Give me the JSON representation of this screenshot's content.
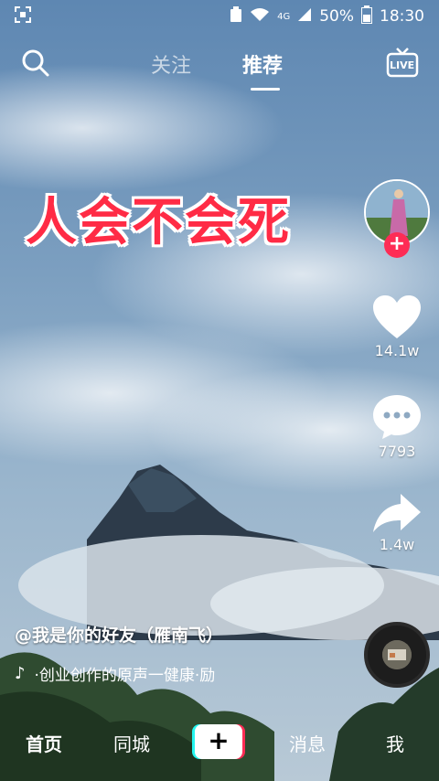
{
  "status_bar": {
    "battery": "50%",
    "time": "18:30",
    "network": "4G"
  },
  "top_nav": {
    "tabs": [
      {
        "label": "关注"
      },
      {
        "label": "推荐"
      }
    ],
    "live_label": "LIVE"
  },
  "video": {
    "banner_text": "人会不会死",
    "author": "@我是你的好友（雁南飞）",
    "music": "·创业创作的原声一健康·励"
  },
  "actions": {
    "likes": "14.1w",
    "comments": "7793",
    "shares": "1.4w"
  },
  "bottom_nav": {
    "home": "首页",
    "city": "同城",
    "plus": "+",
    "messages": "消息",
    "me": "我"
  },
  "colors": {
    "accent": "#fe2c55",
    "accent_cyan": "#24f6f0",
    "banner_red": "#ff2b45"
  }
}
